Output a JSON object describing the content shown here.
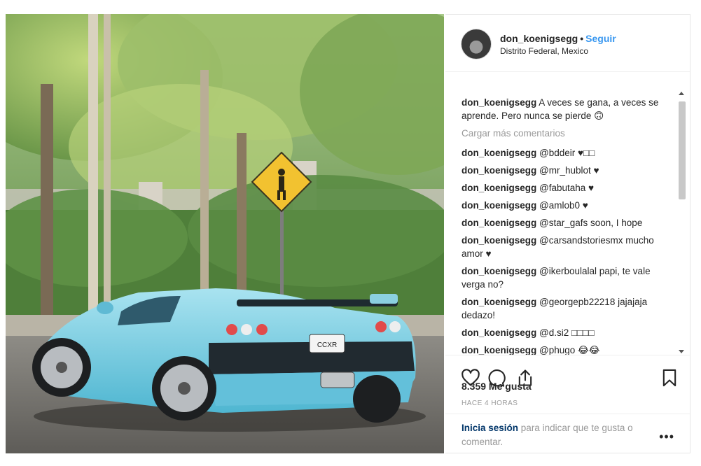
{
  "header": {
    "username": "don_koenigsegg",
    "separator": "•",
    "follow_label": "Seguir",
    "location": "Distrito Federal, Mexico"
  },
  "caption": {
    "user": "don_koenigsegg",
    "text": "A veces se gana, a veces se aprende. Pero nunca se pierde 🙃"
  },
  "load_more_label": "Cargar más comentarios",
  "comments": [
    {
      "user": "don_koenigsegg",
      "text": "@bddeir ♥□□"
    },
    {
      "user": "don_koenigsegg",
      "text": "@mr_hublot ♥"
    },
    {
      "user": "don_koenigsegg",
      "text": "@fabutaha ♥"
    },
    {
      "user": "don_koenigsegg",
      "text": "@amlob0 ♥"
    },
    {
      "user": "don_koenigsegg",
      "text": "@star_gafs soon, I hope"
    },
    {
      "user": "don_koenigsegg",
      "text": "@carsandstoriesmx mucho amor ♥"
    },
    {
      "user": "don_koenigsegg",
      "text": "@ikerboulalal papi, te vale verga no?"
    },
    {
      "user": "don_koenigsegg",
      "text": "@georgepb22218 jajajaja dedazo!"
    },
    {
      "user": "don_koenigsegg",
      "text": "@d.si2 □□□□"
    },
    {
      "user": "don_koenigsegg",
      "text": "@phugo 😂😂"
    }
  ],
  "likes": "8.359 Me gusta",
  "timestamp": "HACE 4 HORAS",
  "footer": {
    "login_link": "Inicia sesión",
    "login_rest": " para indicar que te gusta o comentar.",
    "more_label": "•••"
  },
  "icons": {
    "like": "heart-icon",
    "comment": "comment-bubble-icon",
    "share": "share-icon",
    "save": "bookmark-icon",
    "more": "more-options-icon"
  },
  "colors": {
    "follow": "#3897f0",
    "car_body": "#6cc6dc",
    "muted_text": "#999999"
  },
  "plate_text": "CCXR"
}
